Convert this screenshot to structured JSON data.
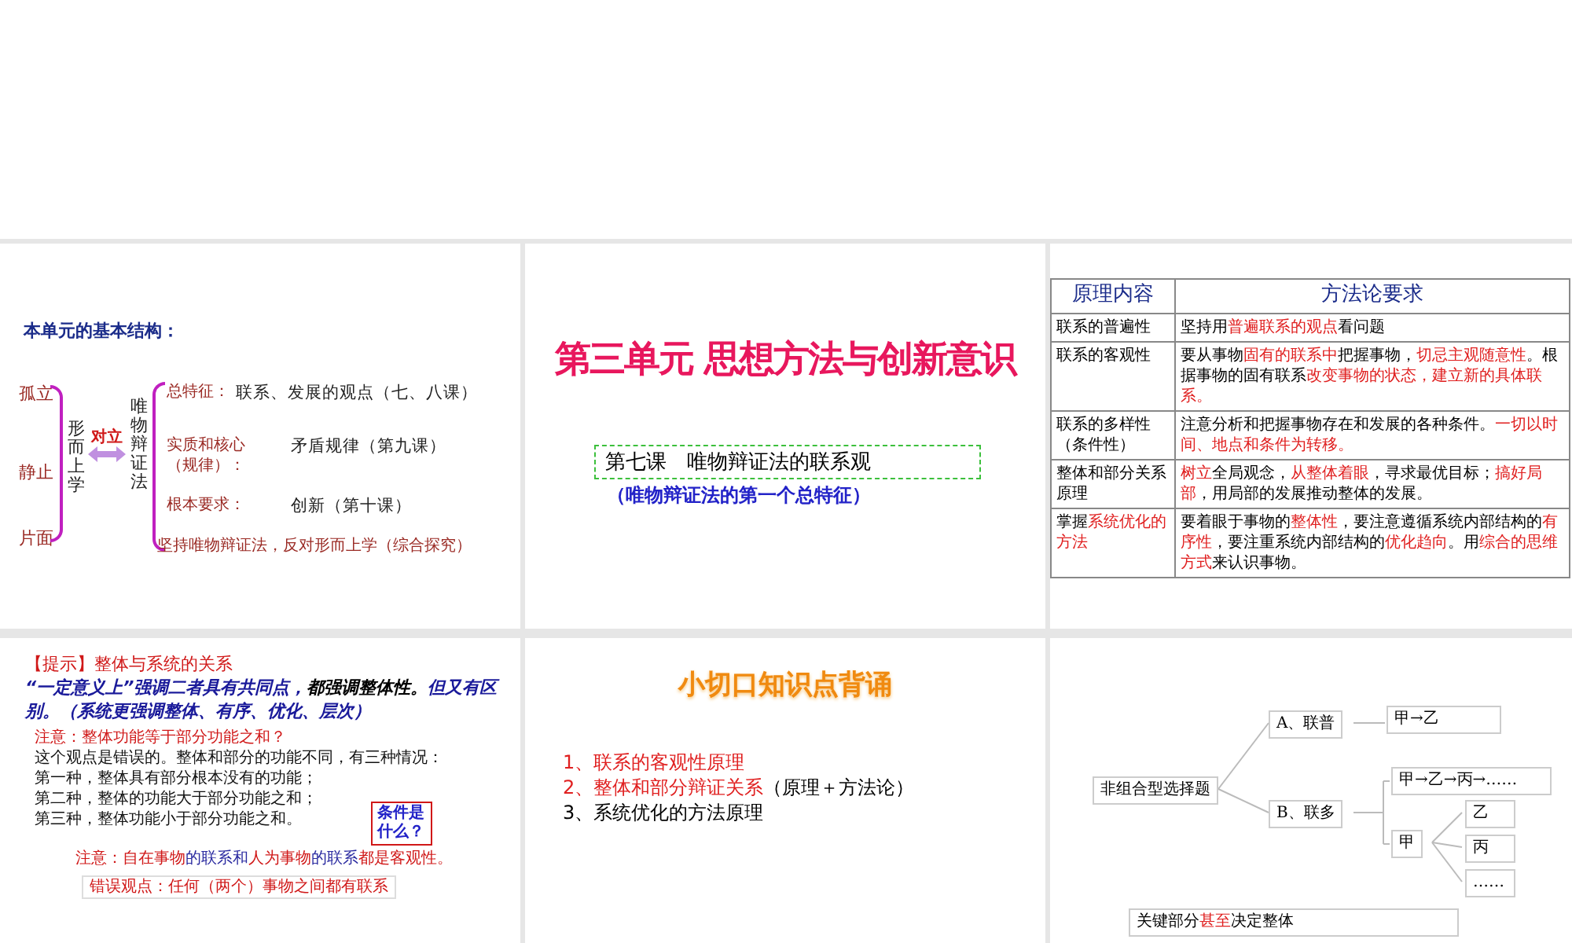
{
  "slides": [
    {
      "kind": "structure",
      "heading": "本单元的基本结构：",
      "left_terms": [
        "孤立",
        "静止",
        "片面"
      ],
      "vertical_left": "形而上学",
      "arrow_label": "对立",
      "vertical_right": "唯物辩证法",
      "items": [
        {
          "label": [
            "总特征："
          ],
          "text": "联系、发展的观点（七、八课）"
        },
        {
          "label": [
            "实质和核心",
            "（规律）："
          ],
          "text": "矛盾规律（第九课）"
        },
        {
          "label": [
            "根本要求："
          ],
          "text": "创新（第十课）"
        }
      ],
      "footer": "坚持唯物辩证法，反对形而上学（综合探究）"
    },
    {
      "kind": "title",
      "title": "第三单元  思想方法与创新意识",
      "lesson": "第七课　唯物辩证法的联系观",
      "subtitle": "（唯物辩证法的第一个总特征）"
    },
    {
      "kind": "table",
      "columns": [
        "原理内容",
        "方法论要求"
      ],
      "rows": [
        {
          "principle": [
            {
              "text": "联系的普遍性",
              "color": "#000000"
            }
          ],
          "method": [
            {
              "text": "坚持用",
              "color": "#000000"
            },
            {
              "text": "普遍联系的观点",
              "color": "#e02020"
            },
            {
              "text": "看问题",
              "color": "#000000"
            }
          ]
        },
        {
          "principle": [
            {
              "text": "联系的客观性",
              "color": "#000000"
            }
          ],
          "method": [
            {
              "text": "要从事物",
              "color": "#000000"
            },
            {
              "text": "固有的联系中",
              "color": "#e02020"
            },
            {
              "text": "把握事物，",
              "color": "#000000"
            },
            {
              "text": "切忌主观随意性",
              "color": "#e02020"
            },
            {
              "text": "。根据事物的固有联系",
              "color": "#000000"
            },
            {
              "text": "改变事物的状态，建立新的具体联系。",
              "color": "#e02020"
            }
          ]
        },
        {
          "principle": [
            {
              "text": "联系的多样性（条件性）",
              "color": "#000000"
            }
          ],
          "method": [
            {
              "text": "注意分析和把握事物存在和发展的各种条件。",
              "color": "#000000"
            },
            {
              "text": "一切以时间、地点和条件为转移。",
              "color": "#e02020"
            }
          ]
        },
        {
          "principle": [
            {
              "text": "整体和部分关系原理",
              "color": "#000000"
            }
          ],
          "method": [
            {
              "text": "树立",
              "color": "#e02020"
            },
            {
              "text": "全局观念，",
              "color": "#000000"
            },
            {
              "text": "从整体着眼",
              "color": "#e02020"
            },
            {
              "text": "，寻求最优目标；",
              "color": "#000000"
            },
            {
              "text": "搞好局部",
              "color": "#e02020"
            },
            {
              "text": "，用局部的发展推动整体的发展。",
              "color": "#000000"
            }
          ]
        },
        {
          "principle": [
            {
              "text": "掌握",
              "color": "#000000"
            },
            {
              "text": "系统优化的方法",
              "color": "#e02020"
            }
          ],
          "method": [
            {
              "text": "要着眼于事物的",
              "color": "#000000"
            },
            {
              "text": "整体性",
              "color": "#e02020"
            },
            {
              "text": "，要注意遵循系统内部结构的",
              "color": "#000000"
            },
            {
              "text": "有序性",
              "color": "#e02020"
            },
            {
              "text": "，要注重系统内部结构的",
              "color": "#000000"
            },
            {
              "text": "优化趋向",
              "color": "#e02020"
            },
            {
              "text": "。用",
              "color": "#000000"
            },
            {
              "text": "综合的思维方式",
              "color": "#e02020"
            },
            {
              "text": "来认识事物。",
              "color": "#000000"
            }
          ]
        }
      ]
    },
    {
      "kind": "notes",
      "heading": "【提示】整体与系统的关系",
      "paragraph": [
        {
          "text": "“一定意义上”强调二者具有共同点，",
          "color": "#1a1a9a"
        },
        {
          "text": "都强调整体性。",
          "color": "#000000"
        },
        {
          "text": "但又有区别。（系统更强调整体、有序、优化、层次）",
          "color": "#1a1a9a"
        }
      ],
      "question": "注意：整体功能等于部分功能之和？",
      "lines": [
        "这个观点是错误的。整体和部分的功能不同，有三种情况：",
        "第一种，整体具有部分根本没有的功能；",
        "第二种，整体的功能大于部分功能之和；",
        "第三种，整体功能小于部分功能之和。"
      ],
      "callout": "条件是什么？",
      "note": [
        {
          "text": "注意：自在事物",
          "color": "#d01818"
        },
        {
          "text": "的联系和",
          "color": "#2a2aa0"
        },
        {
          "text": "人为事物",
          "color": "#d01818"
        },
        {
          "text": "的联系",
          "color": "#2a2aa0"
        },
        {
          "text": "都是客观性。",
          "color": "#d01818"
        }
      ],
      "boxed": "错误观点：任何（两个）事物之间都有联系"
    },
    {
      "kind": "outline",
      "title": "小切口知识点背诵",
      "items": [
        [
          {
            "text": "1、联系的客观性原理",
            "color": "#e02020"
          }
        ],
        [
          {
            "text": "2、整体和部分辩证关系",
            "color": "#e02020"
          },
          {
            "text": "（原理＋方法论）",
            "color": "#000000"
          }
        ],
        [
          {
            "text": "3、系统优化的方法原理",
            "color": "#000000"
          }
        ]
      ]
    },
    {
      "kind": "tree",
      "root": "非组合型选择题",
      "branches": [
        {
          "label": "A、联普",
          "children": [
            {
              "text": "甲→乙"
            }
          ]
        },
        {
          "label": "B、联多",
          "children": [
            {
              "text": "甲→乙→丙→……"
            },
            {
              "text": "甲",
              "children": [
                {
                  "text": "乙"
                },
                {
                  "text": "丙"
                },
                {
                  "text": "……"
                }
              ]
            }
          ]
        }
      ],
      "bottom": [
        {
          "text": "关键部分",
          "color": "#000000"
        },
        {
          "text": "甚至",
          "color": "#e02020"
        },
        {
          "text": "决定整体",
          "color": "#000000"
        }
      ]
    }
  ]
}
